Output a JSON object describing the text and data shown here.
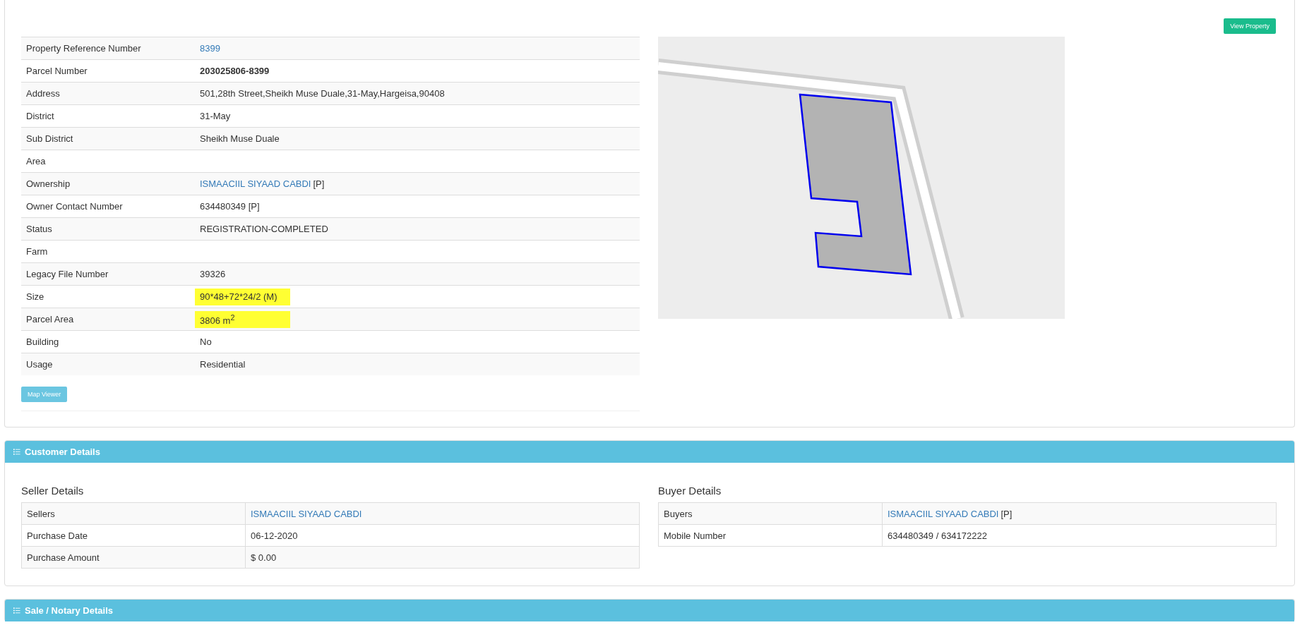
{
  "property": {
    "view_button": "View Property",
    "map_button": "Map Viewer",
    "rows": [
      {
        "label": "Property Reference Number",
        "value": "8399",
        "kind": "link",
        "highlighted": false
      },
      {
        "label": "Parcel Number",
        "value": "203025806-8399",
        "kind": "bold",
        "highlighted": false
      },
      {
        "label": "Address",
        "value": "501,28th Street,Sheikh Muse Duale,31-May,Hargeisa,90408",
        "kind": "text",
        "highlighted": false
      },
      {
        "label": "District",
        "value": "31-May",
        "kind": "text",
        "highlighted": false
      },
      {
        "label": "Sub District",
        "value": "Sheikh Muse Duale",
        "kind": "text",
        "highlighted": false
      },
      {
        "label": "Area",
        "highlighted": false
      },
      {
        "label": "Ownership",
        "value": "ISMAACIIL SIYAAD CABDI",
        "suffix": "[P]",
        "kind": "link",
        "highlighted": false
      },
      {
        "label": "Owner Contact Number",
        "value": "634480349 [P]",
        "kind": "text",
        "highlighted": false
      },
      {
        "label": "Status",
        "value": "REGISTRATION-COMPLETED",
        "kind": "text",
        "highlighted": false
      },
      {
        "label": "Farm",
        "highlighted": false
      },
      {
        "label": "Legacy File Number",
        "value": "39326",
        "kind": "text",
        "highlighted": false
      },
      {
        "label": "Size",
        "value": "90*48+72*24/2 (M)",
        "kind": "text",
        "highlighted": true
      },
      {
        "label": "Parcel Area",
        "value": "3806 m$^{2}$",
        "kind": "text",
        "highlighted": true
      },
      {
        "label": "Building",
        "value": "No",
        "kind": "text",
        "highlighted": false
      },
      {
        "label": "Usage",
        "value": "Residential",
        "kind": "text",
        "highlighted": false
      }
    ]
  },
  "customer_details": {
    "title": "Customer Details",
    "seller": {
      "title": "Seller Details",
      "rows": [
        {
          "label": "Sellers",
          "value": "ISMAACIIL SIYAAD CABDI",
          "kind": "link"
        },
        {
          "label": "Purchase Date",
          "value": "06-12-2020",
          "kind": "text"
        },
        {
          "label": "Purchase Amount",
          "value": "$ 0.00",
          "kind": "text"
        }
      ]
    },
    "buyer": {
      "title": "Buyer Details",
      "rows": [
        {
          "label": "Buyers",
          "value": "ISMAACIIL SIYAAD CABDI",
          "suffix": "[P]",
          "kind": "link"
        },
        {
          "label": "Mobile Number",
          "value": "634480349 / 634172222",
          "kind": "text"
        }
      ]
    }
  },
  "sale_notary": {
    "title": "Sale / Notary Details"
  }
}
